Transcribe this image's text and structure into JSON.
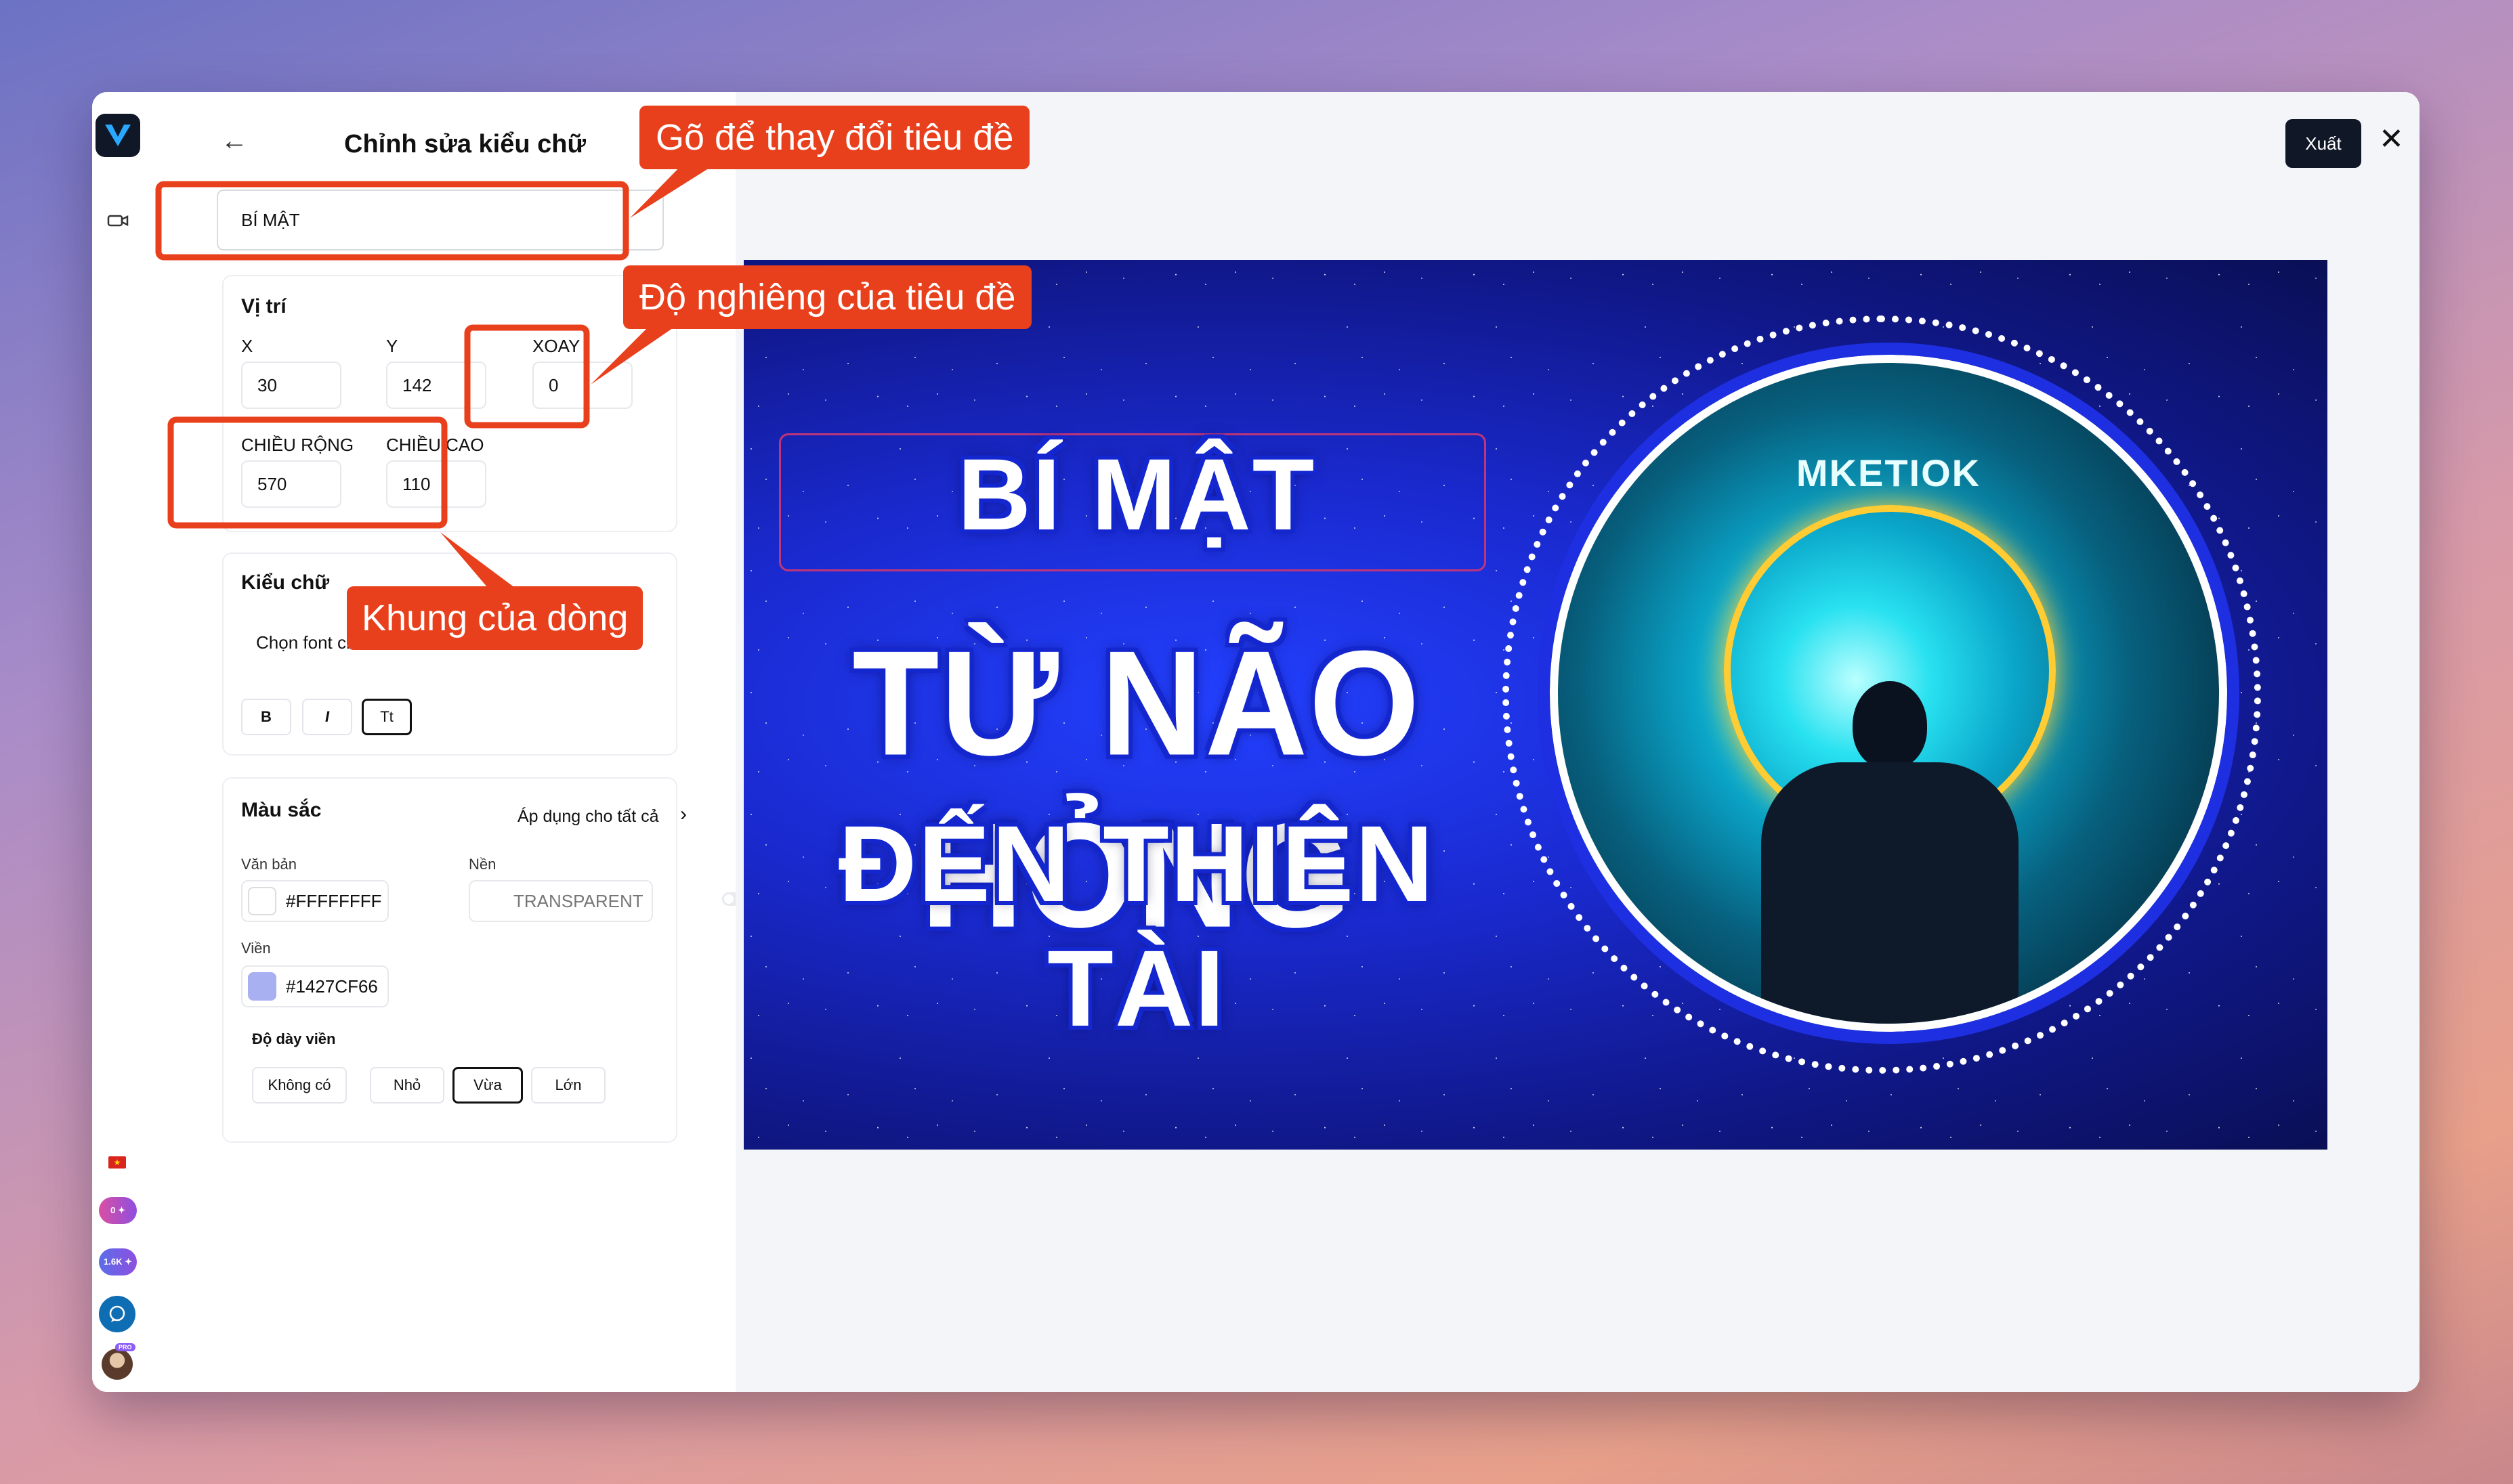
{
  "panel": {
    "title": "Chỉnh sửa kiểu chữ",
    "title_value": "BÍ MẬT",
    "position": {
      "section": "Vị trí",
      "x_label": "X",
      "x": "30",
      "y_label": "Y",
      "y": "142",
      "rotate_label": "XOAY",
      "rotate": "0",
      "width_label": "CHIỀU RỘNG",
      "width": "570",
      "height_label": "CHIỀU CAO",
      "height": "110"
    },
    "font": {
      "section": "Kiểu chữ",
      "select_placeholder": "Chọn font chữ",
      "bold": "B",
      "italic": "I",
      "case": "Tt"
    },
    "color": {
      "section": "Màu sắc",
      "apply_all": "Áp dụng cho tất cả",
      "text_label": "Văn bản",
      "text_value": "#FFFFFFFF",
      "bg_label": "Nền",
      "bg_value": "TRANSPARENT",
      "stroke_label": "Viền",
      "stroke_value": "#1427CF66",
      "thickness_label": "Độ dày viền",
      "thickness_options": [
        "Không có",
        "Nhỏ",
        "Vừa",
        "Lớn"
      ],
      "thickness_selected": "Vừa"
    }
  },
  "rail": {
    "badge_1": "0 ✦",
    "badge_2": "1.6K ✦",
    "pro": "PRO"
  },
  "header": {
    "export": "Xuất"
  },
  "callouts": {
    "title_tip": "Gõ để thay đổi tiêu đề",
    "rotate_tip": "Độ nghiêng của tiêu đề",
    "frame_tip": "Khung của dòng"
  },
  "thumbnail": {
    "line1": "BÍ MẬT",
    "line2": "TỪ NÃO HỎNG",
    "line3": "ĐẾN THIÊN TÀI",
    "logo_text": "MKETIOK"
  },
  "colors": {
    "accent": "#101828",
    "callout": "#e8401c",
    "stroke": "#1427CF",
    "stroke_swatch": "#a9b0f2"
  }
}
